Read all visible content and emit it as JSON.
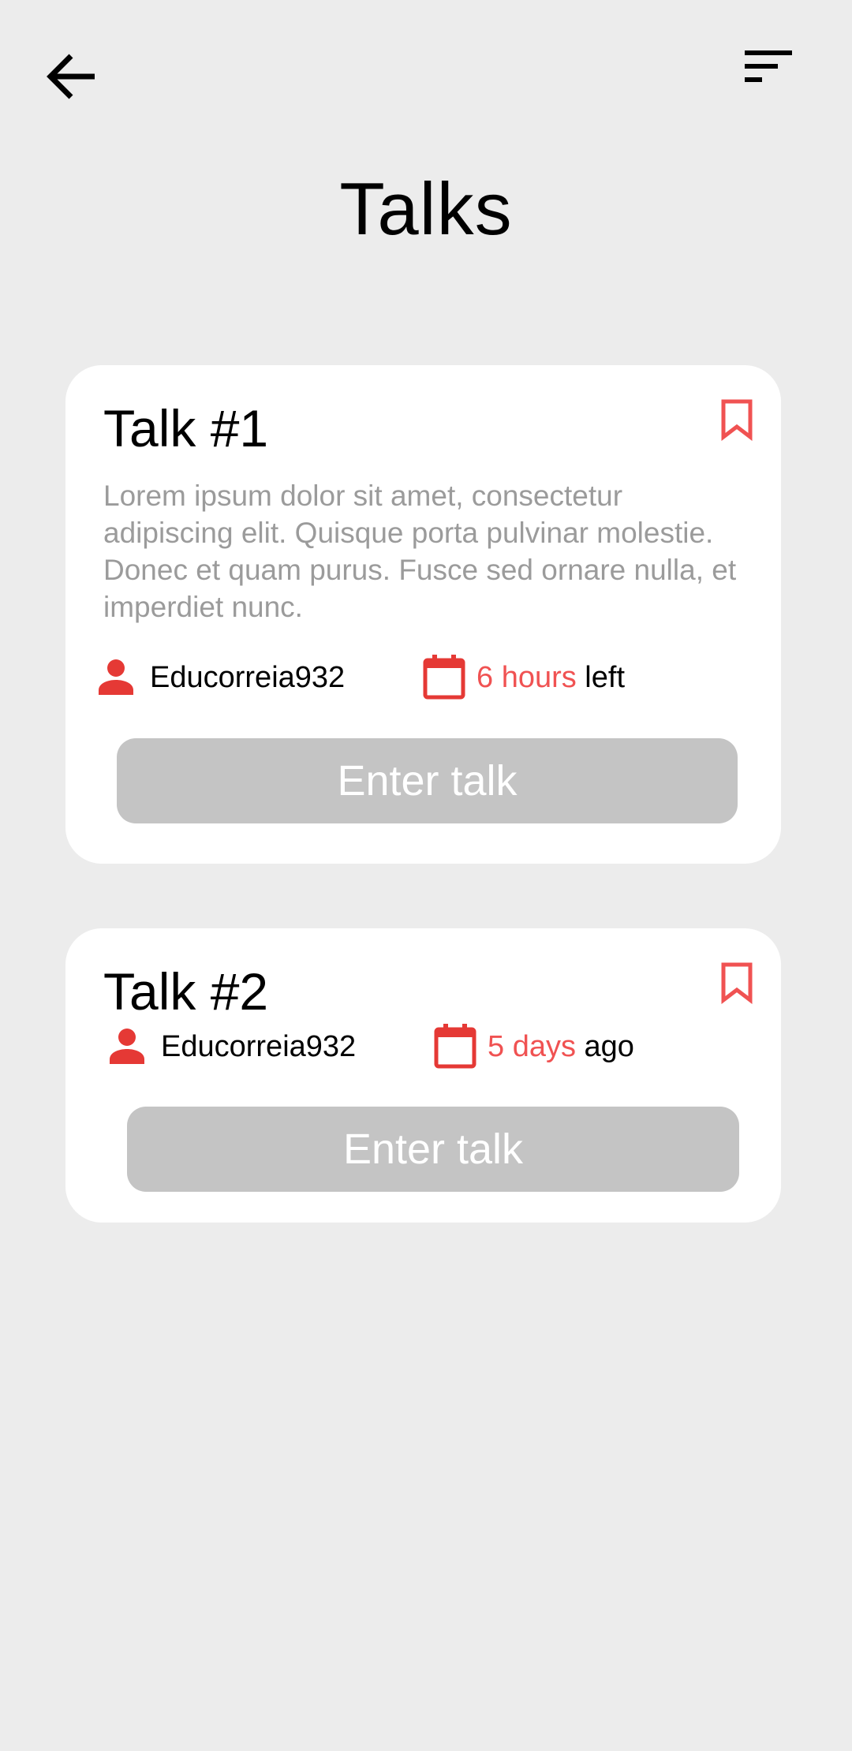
{
  "header": {
    "back_icon": "arrow-left-icon",
    "filter_icon": "sort-filter-icon",
    "title": "Talks"
  },
  "colors": {
    "background": "#ececec",
    "card": "#ffffff",
    "accent": "#f05252",
    "button": "#c4c4c4",
    "muted_text": "#9b9b9b"
  },
  "talks": [
    {
      "title": "Talk #1",
      "description": "Lorem ipsum dolor sit amet, consectetur adipiscing elit. Quisque porta pulvinar molestie. Donec et quam purus. Fusce sed ornare nulla, et imperdiet nunc.",
      "author": "Educorreia932",
      "time_value": "6 hours",
      "time_suffix": " left",
      "button_label": "Enter talk",
      "bookmark_icon": "bookmark-icon",
      "user_icon": "person-icon",
      "calendar_icon": "calendar-icon"
    },
    {
      "title": "Talk #2",
      "author": "Educorreia932",
      "time_value": "5 days",
      "time_suffix": " ago",
      "button_label": "Enter talk",
      "bookmark_icon": "bookmark-icon",
      "user_icon": "person-icon",
      "calendar_icon": "calendar-icon"
    }
  ]
}
